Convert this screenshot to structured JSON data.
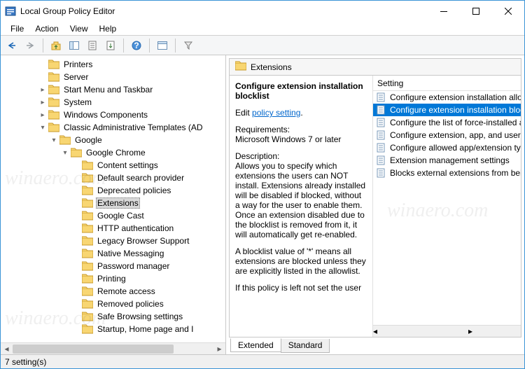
{
  "window": {
    "title": "Local Group Policy Editor"
  },
  "menu": {
    "file": "File",
    "action": "Action",
    "view": "View",
    "help": "Help"
  },
  "tree": {
    "items": [
      {
        "indent": 3,
        "exp": "",
        "label": "Printers"
      },
      {
        "indent": 3,
        "exp": "",
        "label": "Server"
      },
      {
        "indent": 3,
        "exp": "▸",
        "label": "Start Menu and Taskbar"
      },
      {
        "indent": 3,
        "exp": "▸",
        "label": "System"
      },
      {
        "indent": 3,
        "exp": "▸",
        "label": "Windows Components"
      },
      {
        "indent": 3,
        "exp": "▾",
        "label": "Classic Administrative Templates (AD"
      },
      {
        "indent": 4,
        "exp": "▾",
        "label": "Google"
      },
      {
        "indent": 5,
        "exp": "▾",
        "label": "Google Chrome"
      },
      {
        "indent": 6,
        "exp": "",
        "label": "Content settings"
      },
      {
        "indent": 6,
        "exp": "",
        "label": "Default search provider"
      },
      {
        "indent": 6,
        "exp": "",
        "label": "Deprecated policies"
      },
      {
        "indent": 6,
        "exp": "",
        "label": "Extensions",
        "selected": true
      },
      {
        "indent": 6,
        "exp": "",
        "label": "Google Cast"
      },
      {
        "indent": 6,
        "exp": "",
        "label": "HTTP authentication"
      },
      {
        "indent": 6,
        "exp": "",
        "label": "Legacy Browser Support"
      },
      {
        "indent": 6,
        "exp": "",
        "label": "Native Messaging"
      },
      {
        "indent": 6,
        "exp": "",
        "label": "Password manager"
      },
      {
        "indent": 6,
        "exp": "",
        "label": "Printing"
      },
      {
        "indent": 6,
        "exp": "",
        "label": "Remote access"
      },
      {
        "indent": 6,
        "exp": "",
        "label": "Removed policies"
      },
      {
        "indent": 6,
        "exp": "",
        "label": "Safe Browsing settings"
      },
      {
        "indent": 6,
        "exp": "",
        "label": "Startup, Home page and I"
      }
    ]
  },
  "right": {
    "header": "Extensions",
    "policy_name": "Configure extension installation blocklist",
    "edit_prefix": "Edit ",
    "edit_link": "policy setting",
    "req_label": "Requirements:",
    "req_value": "Microsoft Windows 7 or later",
    "desc_label": "Description:",
    "desc_body": "Allows you to specify which extensions the users can NOT install. Extensions already installed will be disabled if blocked, without a way for the user to enable them. Once an extension disabled due to the blocklist is removed from it, it will automatically get re-enabled.",
    "desc_body2": "A blocklist value of '*' means all extensions are blocked unless they are explicitly listed in the allowlist.",
    "desc_body3": "If this policy is left not set the user",
    "list_header": "Setting",
    "settings": [
      {
        "label": "Configure extension installation allow list"
      },
      {
        "label": "Configure extension installation blocklist",
        "selected": true
      },
      {
        "label": "Configure the list of force-installed apps a"
      },
      {
        "label": "Configure extension, app, and user script"
      },
      {
        "label": "Configure allowed app/extension types"
      },
      {
        "label": "Extension management settings"
      },
      {
        "label": "Blocks external extensions from being ins"
      }
    ]
  },
  "tabs": {
    "extended": "Extended",
    "standard": "Standard"
  },
  "status": "7 setting(s)",
  "watermark": "winaero.com"
}
